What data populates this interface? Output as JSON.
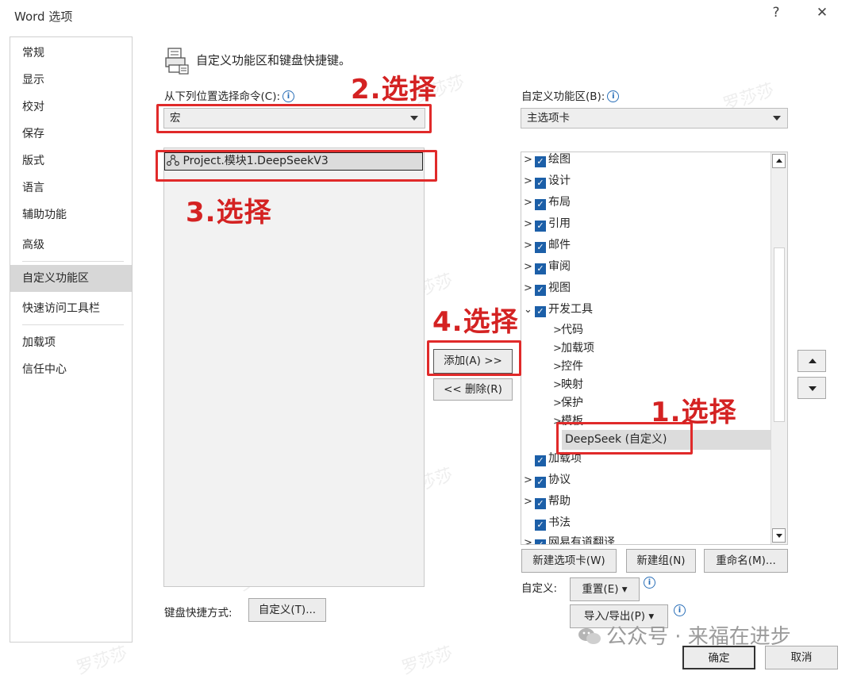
{
  "window": {
    "title": "Word 选项",
    "help": "?",
    "close": "✕"
  },
  "sidebar": {
    "items": [
      {
        "label": "常规"
      },
      {
        "label": "显示"
      },
      {
        "label": "校对"
      },
      {
        "label": "保存"
      },
      {
        "label": "版式"
      },
      {
        "label": "语言"
      },
      {
        "label": "辅助功能"
      },
      {
        "label": "高级"
      },
      {
        "label": "自定义功能区"
      },
      {
        "label": "快速访问工具栏"
      },
      {
        "label": "加载项"
      },
      {
        "label": "信任中心"
      }
    ],
    "selected": "自定义功能区"
  },
  "main": {
    "header": "自定义功能区和键盘快捷键。",
    "commands_from": {
      "label": "从下列位置选择命令(C):",
      "value": "宏"
    },
    "commands_list": [
      {
        "label": "Project.模块1.DeepSeekV3"
      }
    ],
    "customize_ribbon": {
      "label": "自定义功能区(B):",
      "value": "主选项卡"
    },
    "tabs": [
      {
        "label": "绘图"
      },
      {
        "label": "设计"
      },
      {
        "label": "布局"
      },
      {
        "label": "引用"
      },
      {
        "label": "邮件"
      },
      {
        "label": "审阅"
      },
      {
        "label": "视图"
      },
      {
        "label": "开发工具"
      },
      {
        "label": "代码"
      },
      {
        "label": "加载项"
      },
      {
        "label": "控件"
      },
      {
        "label": "映射"
      },
      {
        "label": "保护"
      },
      {
        "label": "模板"
      },
      {
        "label": "DeepSeek (自定义)"
      },
      {
        "label": "加载项"
      },
      {
        "label": "协议"
      },
      {
        "label": "帮助"
      },
      {
        "label": "书法"
      },
      {
        "label": "网易有道翻译"
      }
    ],
    "add_button": "添加(A) >>",
    "remove_button": "<< 删除(R)",
    "new_tab_button": "新建选项卡(W)",
    "new_group_button": "新建组(N)",
    "rename_button": "重命名(M)...",
    "customizations_label": "自定义:",
    "reset_button": "重置(E) ▾",
    "import_export_button": "导入/导出(P) ▾",
    "keyboard_label": "键盘快捷方式:",
    "keyboard_button": "自定义(T)...",
    "ok_button": "确定",
    "cancel_button": "取消"
  },
  "annotations": {
    "step1": "1.选择",
    "step2": "2.选择",
    "step3": "3.选择",
    "step4": "4.选择",
    "color": "#e02a2a"
  },
  "watermark": {
    "text": "罗莎莎",
    "wechat": "公众号 · 来福在进步"
  },
  "colors": {
    "checkbox": "#1c5fa8",
    "selection": "#dcdcdc",
    "annotation": "#e02a2a"
  }
}
